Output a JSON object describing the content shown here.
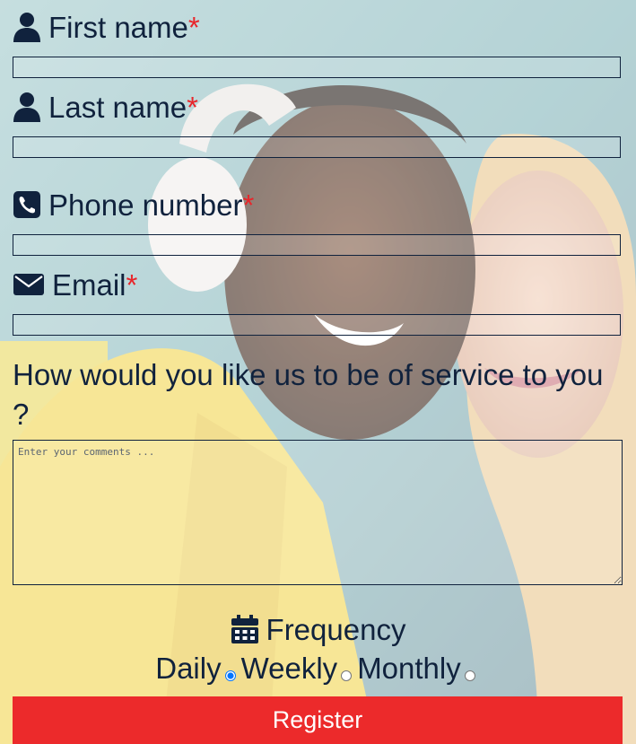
{
  "colors": {
    "text": "#10223d",
    "required": "#e8262b",
    "button": "#ec2a2b",
    "button_text": "#ffffff"
  },
  "form": {
    "first_name": {
      "label": "First name",
      "required_mark": "*",
      "icon": "user-icon",
      "value": ""
    },
    "last_name": {
      "label": "Last name",
      "required_mark": "*",
      "icon": "user-icon",
      "value": ""
    },
    "phone": {
      "label": "Phone number",
      "required_mark": "*",
      "icon": "phone-icon",
      "value": ""
    },
    "email": {
      "label": "Email",
      "required_mark": "*",
      "icon": "envelope-icon",
      "value": ""
    },
    "service_question": "How would you like us to be of service to you ?",
    "comments": {
      "placeholder": "Enter your comments ...",
      "value": ""
    },
    "frequency": {
      "title": "Frequency",
      "icon": "calendar-icon",
      "options": [
        "Daily",
        "Weekly",
        "Monthly"
      ],
      "selected": "Daily"
    },
    "register_label": "Register"
  }
}
